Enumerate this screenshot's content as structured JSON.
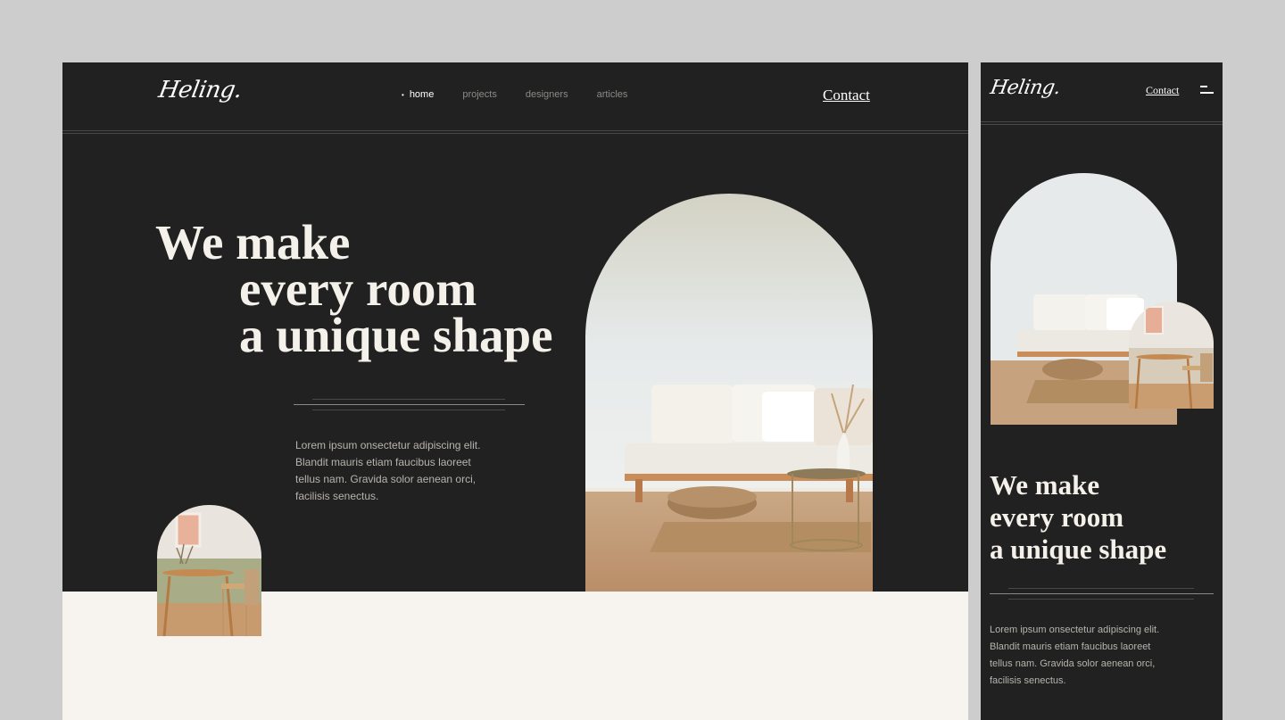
{
  "desktop": {
    "logo": "Heling.",
    "nav": [
      "home",
      "projects",
      "designers",
      "articles"
    ],
    "contact": "Contact",
    "headline": [
      "We make",
      "every room",
      "a unique shape"
    ],
    "paragraph": [
      "Lorem ipsum onsectetur adipiscing elit.",
      "Blandit mauris etiam faucibus laoreet",
      "tellus nam. Gravida solor aenean orci,",
      "facilisis senectus."
    ]
  },
  "mobile": {
    "logo": "Heling.",
    "contact": "Contact",
    "headline": [
      "We make",
      "every room",
      "a unique shape"
    ],
    "paragraph": [
      "Lorem ipsum onsectetur adipiscing elit.",
      "Blandit mauris etiam faucibus laoreet",
      "tellus nam. Gravida solor aenean orci,",
      "facilisis senectus."
    ]
  },
  "icons": [
    "menu-icon"
  ]
}
